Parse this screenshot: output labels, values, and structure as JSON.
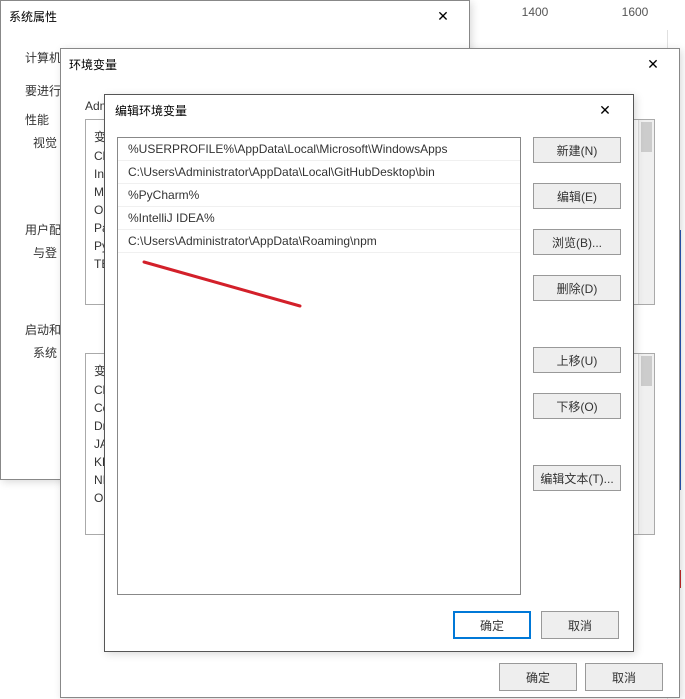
{
  "ruler": {
    "m1": "1400",
    "m2": "1600"
  },
  "sys_props": {
    "title": "系统属性",
    "labels": {
      "computer_name": "计算机名",
      "must_proceed": "要进行",
      "performance": "性能",
      "visual": "视觉",
      "user_config": "用户配",
      "login": "与登",
      "startup": "启动和",
      "system": "系统"
    }
  },
  "env_vars": {
    "title": "环境变量",
    "group_adm": "Adm",
    "user_list": [
      "变",
      "Cl",
      "In",
      "M",
      "O",
      "Pa",
      "Py",
      "TE"
    ],
    "sys_list": [
      "变",
      "Cl",
      "Co",
      "Dr",
      "JA",
      "KL",
      "NI",
      "O"
    ],
    "ok": "确定",
    "cancel": "取消"
  },
  "edit_var": {
    "title": "编辑环境变量",
    "paths": [
      "%USERPROFILE%\\AppData\\Local\\Microsoft\\WindowsApps",
      "C:\\Users\\Administrator\\AppData\\Local\\GitHubDesktop\\bin",
      "%PyCharm%",
      "%IntelliJ IDEA%",
      "C:\\Users\\Administrator\\AppData\\Roaming\\npm"
    ],
    "buttons": {
      "new": "新建(N)",
      "edit": "编辑(E)",
      "browse": "浏览(B)...",
      "delete": "删除(D)",
      "up": "上移(U)",
      "down": "下移(O)",
      "edit_text": "编辑文本(T)...",
      "ok": "确定",
      "cancel": "取消"
    }
  }
}
